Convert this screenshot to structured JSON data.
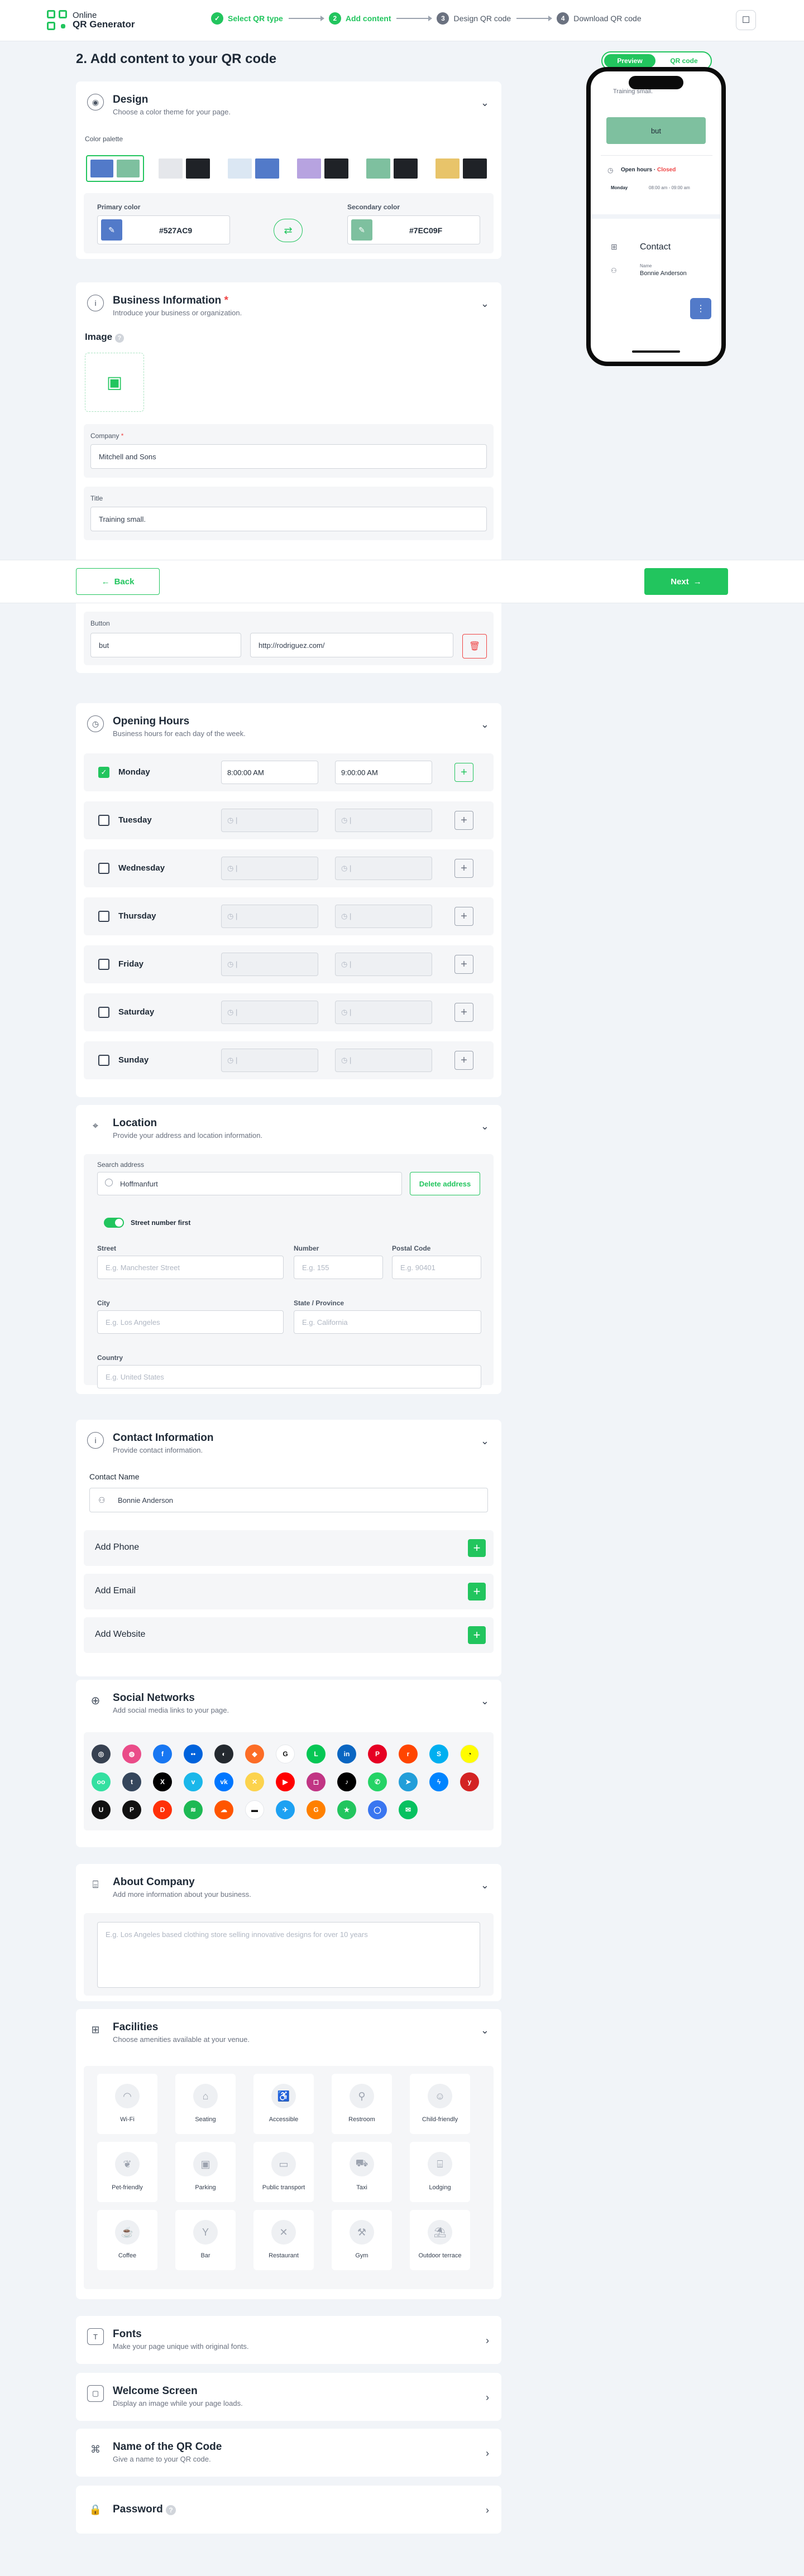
{
  "brand": {
    "line1": "Online",
    "line2": "QR Generator"
  },
  "steps": [
    {
      "num": "✓",
      "label": "Select QR type"
    },
    {
      "num": "2",
      "label": "Add content"
    },
    {
      "num": "3",
      "label": "Design QR code"
    },
    {
      "num": "4",
      "label": "Download QR code"
    }
  ],
  "page_title": "2. Add content to your QR code",
  "design": {
    "title": "Design",
    "subtitle": "Choose a color theme for your page.",
    "palette_label": "Color palette",
    "palettes": [
      [
        "#527AC9",
        "#7EC09F"
      ],
      [
        "#e5e7eb",
        "#1f2227"
      ],
      [
        "#dbe7f3",
        "#527AC9"
      ],
      [
        "#b7a3e0",
        "#1f2227"
      ],
      [
        "#7EC09F",
        "#1f2227"
      ],
      [
        "#e8c46a",
        "#1f2227"
      ]
    ],
    "primary_label": "Primary color",
    "primary_value": "#527AC9",
    "secondary_label": "Secondary color",
    "secondary_value": "#7EC09F"
  },
  "business": {
    "title": "Business Information",
    "subtitle": "Introduce your business or organization.",
    "image_label": "Image",
    "company_label": "Company",
    "company_value": "Mitchell and Sons",
    "title_label": "Title",
    "title_value": "Training small.",
    "button_label": "Button",
    "button_text": "but",
    "button_url": "http://rodriguez.com/"
  },
  "nav": {
    "back": "Back",
    "next": "Next"
  },
  "hours": {
    "title": "Opening Hours",
    "subtitle": "Business hours for each day of the week.",
    "days": [
      {
        "name": "Monday",
        "open": "8:00:00 AM",
        "close": "9:00:00 AM"
      },
      {
        "name": "Tuesday",
        "open": "",
        "close": ""
      },
      {
        "name": "Wednesday",
        "open": "",
        "close": ""
      },
      {
        "name": "Thursday",
        "open": "",
        "close": ""
      },
      {
        "name": "Friday",
        "open": "",
        "close": ""
      },
      {
        "name": "Saturday",
        "open": "",
        "close": ""
      },
      {
        "name": "Sunday",
        "open": "",
        "close": ""
      }
    ]
  },
  "location": {
    "title": "Location",
    "subtitle": "Provide your address and location information.",
    "search_label": "Search address",
    "search_value": "Hoffmanfurt",
    "delete_btn": "Delete address",
    "street_first": "Street number first",
    "street_label": "Street",
    "street_ph": "E.g. Manchester Street",
    "number_label": "Number",
    "number_ph": "E.g. 155",
    "postal_label": "Postal Code",
    "postal_ph": "E.g. 90401",
    "city_label": "City",
    "city_ph": "E.g. Los Angeles",
    "state_label": "State / Province",
    "state_ph": "E.g. California",
    "country_label": "Country",
    "country_ph": "E.g. United States"
  },
  "contact": {
    "title": "Contact Information",
    "subtitle": "Provide contact information.",
    "name_label": "Contact Name",
    "name_value": "Bonnie Anderson",
    "add_phone": "Add Phone",
    "add_email": "Add Email",
    "add_website": "Add Website"
  },
  "social": {
    "title": "Social Networks",
    "subtitle": "Add social media links to your page.",
    "icons": [
      {
        "name": "web",
        "color": "#374151",
        "glyph": "◎"
      },
      {
        "name": "dribbble",
        "color": "#ea4c89",
        "glyph": "◍"
      },
      {
        "name": "facebook",
        "color": "#1877f2",
        "glyph": "f"
      },
      {
        "name": "flickr",
        "color": "#0063dc",
        "glyph": "••"
      },
      {
        "name": "github",
        "color": "#24292f",
        "glyph": "◐"
      },
      {
        "name": "gitlab",
        "color": "#fc6d26",
        "glyph": "◆"
      },
      {
        "name": "google",
        "color": "#ffffff",
        "glyph": "G"
      },
      {
        "name": "line",
        "color": "#06c755",
        "glyph": "L"
      },
      {
        "name": "linkedin",
        "color": "#0a66c2",
        "glyph": "in"
      },
      {
        "name": "pinterest",
        "color": "#e60023",
        "glyph": "P"
      },
      {
        "name": "reddit",
        "color": "#ff4500",
        "glyph": "r"
      },
      {
        "name": "skype",
        "color": "#00aff0",
        "glyph": "S"
      },
      {
        "name": "snapchat",
        "color": "#fffc00",
        "glyph": "◔"
      },
      {
        "name": "tripadvisor",
        "color": "#34e0a1",
        "glyph": "oo"
      },
      {
        "name": "tumblr",
        "color": "#35465c",
        "glyph": "t"
      },
      {
        "name": "x",
        "color": "#000000",
        "glyph": "X"
      },
      {
        "name": "vimeo",
        "color": "#1ab7ea",
        "glyph": "v"
      },
      {
        "name": "vk",
        "color": "#0077ff",
        "glyph": "vk"
      },
      {
        "name": "xing",
        "color": "#fcd34d",
        "glyph": "✕"
      },
      {
        "name": "youtube",
        "color": "#ff0000",
        "glyph": "▶"
      },
      {
        "name": "instagram",
        "color": "#c13584",
        "glyph": "◻"
      },
      {
        "name": "tiktok",
        "color": "#000000",
        "glyph": "♪"
      },
      {
        "name": "whatsapp",
        "color": "#25d366",
        "glyph": "✆"
      },
      {
        "name": "telegram",
        "color": "#229ed9",
        "glyph": "➤"
      },
      {
        "name": "messenger",
        "color": "#0084ff",
        "glyph": "ϟ"
      },
      {
        "name": "yelp",
        "color": "#d32323",
        "glyph": "y"
      },
      {
        "name": "ubereats",
        "color": "#111111",
        "glyph": "U"
      },
      {
        "name": "postmates",
        "color": "#111111",
        "glyph": "P"
      },
      {
        "name": "doordash",
        "color": "#ff3008",
        "glyph": "D"
      },
      {
        "name": "spotify",
        "color": "#1db954",
        "glyph": "≋"
      },
      {
        "name": "soundcloud",
        "color": "#ff5500",
        "glyph": "☁"
      },
      {
        "name": "deliveroo",
        "color": "#ffffff",
        "glyph": "▬"
      },
      {
        "name": "rappi",
        "color": "#1da1f2",
        "glyph": "✈"
      },
      {
        "name": "grubhub",
        "color": "#ff8000",
        "glyph": "G"
      },
      {
        "name": "booking",
        "color": "#22c55e",
        "glyph": "★"
      },
      {
        "name": "signal",
        "color": "#3a76f0",
        "glyph": "◯"
      },
      {
        "name": "wechat",
        "color": "#07c160",
        "glyph": "✉"
      }
    ]
  },
  "about": {
    "title": "About Company",
    "subtitle": "Add more information about your business.",
    "placeholder": "E.g. Los Angeles based clothing store selling innovative designs for over 10 years"
  },
  "facilities": {
    "title": "Facilities",
    "subtitle": "Choose amenities available at your venue.",
    "items": [
      {
        "label": "Wi-Fi",
        "glyph": "◠"
      },
      {
        "label": "Seating",
        "glyph": "⌂"
      },
      {
        "label": "Accessible",
        "glyph": "♿"
      },
      {
        "label": "Restroom",
        "glyph": "⚲"
      },
      {
        "label": "Child-friendly",
        "glyph": "☺"
      },
      {
        "label": "Pet-friendly",
        "glyph": "❦"
      },
      {
        "label": "Parking",
        "glyph": "▣"
      },
      {
        "label": "Public transport",
        "glyph": "▭"
      },
      {
        "label": "Taxi",
        "glyph": "⛟"
      },
      {
        "label": "Lodging",
        "glyph": "⌸"
      },
      {
        "label": "Coffee",
        "glyph": "☕"
      },
      {
        "label": "Bar",
        "glyph": "Y"
      },
      {
        "label": "Restaurant",
        "glyph": "✕"
      },
      {
        "label": "Gym",
        "glyph": "⚒"
      },
      {
        "label": "Outdoor terrace",
        "glyph": "⛱"
      }
    ]
  },
  "fonts": {
    "title": "Fonts",
    "subtitle": "Make your page unique with original fonts."
  },
  "welcome": {
    "title": "Welcome Screen",
    "subtitle": "Display an image while your page loads."
  },
  "qrname": {
    "title": "Name of the QR Code",
    "subtitle": "Give a name to your QR code."
  },
  "password": {
    "title": "Password"
  },
  "preview": {
    "tab_preview": "Preview",
    "tab_qr": "QR code",
    "top_text": "Training small.",
    "button_text": "but",
    "hours_label": "Open hours",
    "hours_status": "Closed",
    "day": "Monday",
    "time": "08:00 am - 09:00 am",
    "contact_title": "Contact",
    "name_label": "Name",
    "name_value": "Bonnie Anderson"
  },
  "colors": {
    "accent": "#22c55e",
    "primary": "#527AC9",
    "secondary": "#7EC09F"
  }
}
